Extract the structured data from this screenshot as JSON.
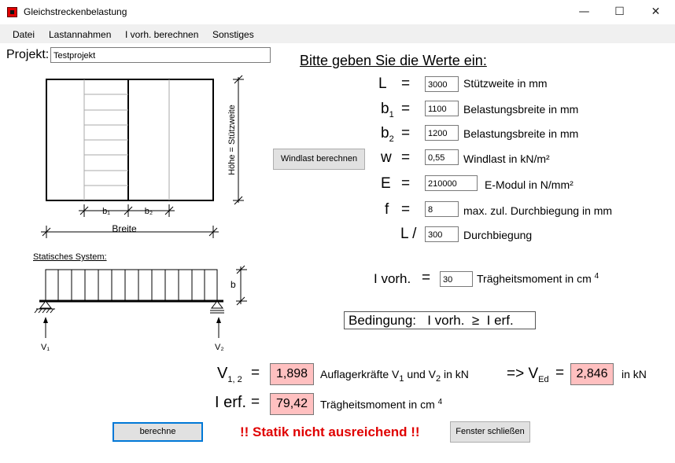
{
  "window": {
    "title": "Gleichstreckenbelastung",
    "minimize": "—",
    "maximize": "☐",
    "close": "✕"
  },
  "menu": [
    "Datei",
    "Lastannahmen",
    "I vorh. berechnen",
    "Sonstiges"
  ],
  "projekt": {
    "label": "Projekt:",
    "value": "Testprojekt"
  },
  "heading": "Bitte geben Sie die Werte ein:",
  "inputs": {
    "L": {
      "sym": "L",
      "value": "3000",
      "desc": "Stützweite in mm"
    },
    "b1": {
      "sym": "b",
      "sub": "1",
      "value": "1100",
      "desc": "Belastungsbreite in mm"
    },
    "b2": {
      "sym": "b",
      "sub": "2",
      "value": "1200",
      "desc": "Belastungsbreite in mm"
    },
    "w": {
      "sym": "w",
      "value": "0,55",
      "desc": "Windlast in kN/m²"
    },
    "E": {
      "sym": "E",
      "value": "210000",
      "desc": "E-Modul in N/mm²"
    },
    "f": {
      "sym": "f",
      "value": "8",
      "desc": "max. zul. Durchbiegung in mm"
    },
    "L_ratio": {
      "sym": "L /",
      "value": "300",
      "desc": "Durchbiegung"
    }
  },
  "eq_sign": "=",
  "windlast_button": "Windlast berechnen",
  "ivorh": {
    "sym": "I vorh.",
    "value": "30",
    "desc": "Trägheitsmoment in cm",
    "sup": "4"
  },
  "bedingung": "Bedingung:   I vorh.  ≥  I erf.",
  "results": {
    "v12": {
      "sym": "V",
      "sub": "1, 2",
      "value": "1,898",
      "desc_a": "Auflagerkräfte V",
      "desc_s1": "1",
      "desc_b": " und V",
      "desc_s2": "2",
      "desc_c": " in kN"
    },
    "ved": {
      "arrow": "=> V",
      "sub": "Ed",
      "value": "2,846",
      "unit": "in kN"
    },
    "ierf": {
      "sym": "I erf.",
      "value": "79,42",
      "desc": "Trägheitsmoment in cm",
      "sup": "4"
    }
  },
  "buttons": {
    "berechne": "berechne",
    "close": "Fenster schließen"
  },
  "warning": "!! Statik nicht ausreichend !!",
  "drawing": {
    "b1": "b₁",
    "b2": "b₂",
    "breite": "Breite",
    "hoehe": "Höhe = Stützweite",
    "system_label": "Statisches System:",
    "b": "b",
    "v1": "V₁",
    "v2": "V₂"
  },
  "colors": {
    "result_bg": "#ffc0c0",
    "warning": "#e00000",
    "menu_bg": "#f0f0f0",
    "button_bg": "#e1e1e1"
  }
}
